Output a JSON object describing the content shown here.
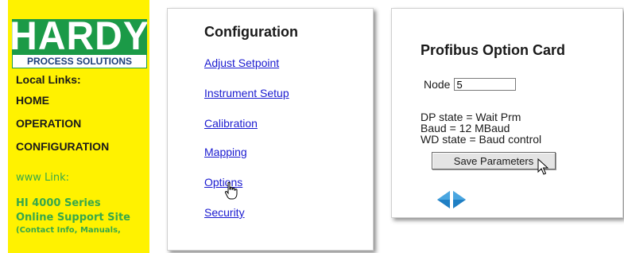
{
  "sidebar": {
    "logo": {
      "brand": "HARDY",
      "tagline": "PROCESS SOLUTIONS"
    },
    "local_links_heading": "Local Links:",
    "local_links": [
      "HOME",
      "OPERATION",
      "CONFIGURATION"
    ],
    "www_link_heading": "www Link:",
    "support_line1": "HI 4000 Series",
    "support_line2": "Online Support Site",
    "support_note": "(Contact Info, Manuals,"
  },
  "config_panel": {
    "title": "Configuration",
    "links": [
      "Adjust Setpoint",
      "Instrument Setup",
      "Calibration",
      "Mapping",
      "Options",
      "Security"
    ]
  },
  "profibus_panel": {
    "title": "Profibus Option Card",
    "node_label": "Node",
    "node_value": "5",
    "status_lines": [
      "DP state = Wait Prm",
      "Baud = 12 MBaud",
      "WD state = Baud control"
    ],
    "save_button": "Save Parameters"
  },
  "colors": {
    "sidebar_bg": "#fff200",
    "logo_green": "#1b9a47",
    "link_blue": "#1a1ad0",
    "arrow_blue": "#1f7fc4"
  },
  "icons": [
    "hand-pointer-cursor-icon",
    "arrow-cursor-icon",
    "arrow-left-icon",
    "arrow-right-icon"
  ]
}
